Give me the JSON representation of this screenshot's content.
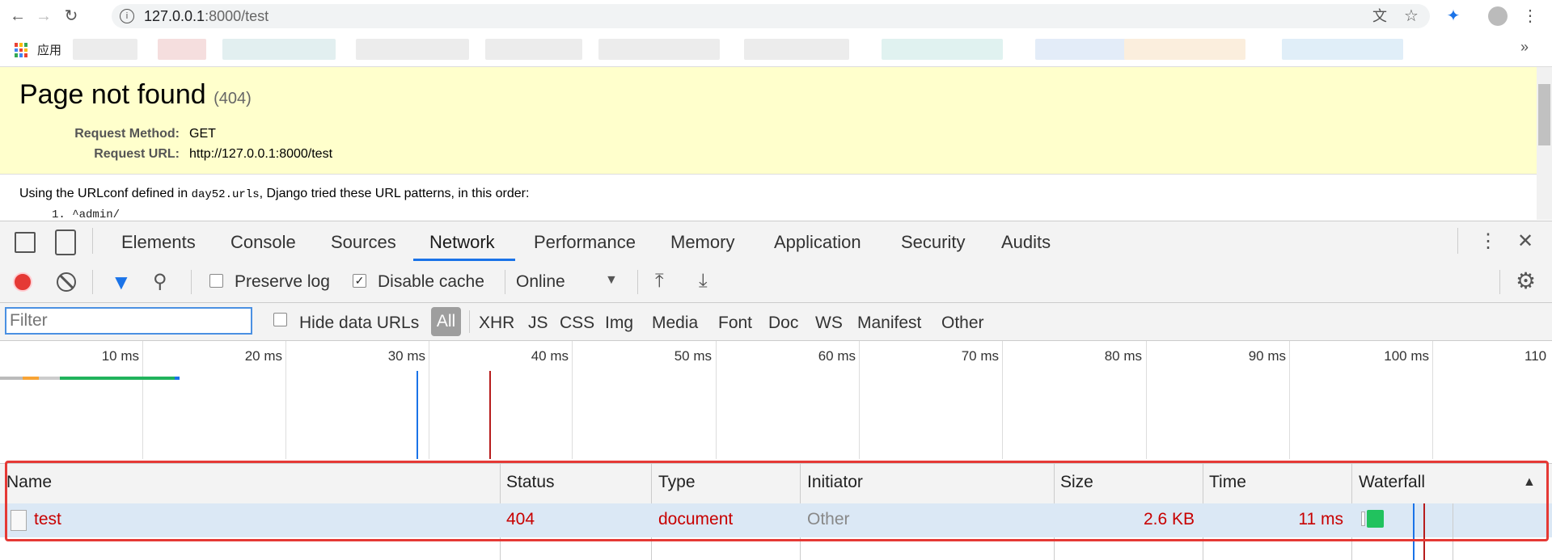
{
  "browser": {
    "url_host": "127.0.0.1",
    "url_rest": ":8000/test",
    "bookmarks_apps_label": "应用",
    "overflow": "»"
  },
  "page": {
    "title": "Page not found",
    "code": "(404)",
    "request_method_label": "Request Method:",
    "request_method_value": "GET",
    "request_url_label": "Request URL:",
    "request_url_value": "http://127.0.0.1:8000/test",
    "urlconf_prefix": "Using the URLconf defined in ",
    "urlconf_module": "day52.urls",
    "urlconf_suffix": ", Django tried these URL patterns, in this order:",
    "pattern_1_index": "1.",
    "pattern_1": "^admin/"
  },
  "devtools": {
    "tabs": [
      "Elements",
      "Console",
      "Sources",
      "Network",
      "Performance",
      "Memory",
      "Application",
      "Security",
      "Audits"
    ],
    "active_tab": "Network",
    "toolbar": {
      "preserve_log": "Preserve log",
      "preserve_log_checked": false,
      "disable_cache": "Disable cache",
      "disable_cache_checked": true,
      "throttling": "Online"
    },
    "filter": {
      "placeholder": "Filter",
      "hide_data_urls": "Hide data URLs",
      "types": [
        "All",
        "XHR",
        "JS",
        "CSS",
        "Img",
        "Media",
        "Font",
        "Doc",
        "WS",
        "Manifest",
        "Other"
      ],
      "active_type": "All"
    },
    "timeline_ticks": [
      "10 ms",
      "20 ms",
      "30 ms",
      "40 ms",
      "50 ms",
      "60 ms",
      "70 ms",
      "80 ms",
      "90 ms",
      "100 ms",
      "110"
    ],
    "columns": [
      "Name",
      "Status",
      "Type",
      "Initiator",
      "Size",
      "Time",
      "Waterfall"
    ],
    "rows": [
      {
        "name": "test",
        "status": "404",
        "type": "document",
        "initiator": "Other",
        "size": "2.6 KB",
        "time": "11 ms"
      }
    ]
  }
}
